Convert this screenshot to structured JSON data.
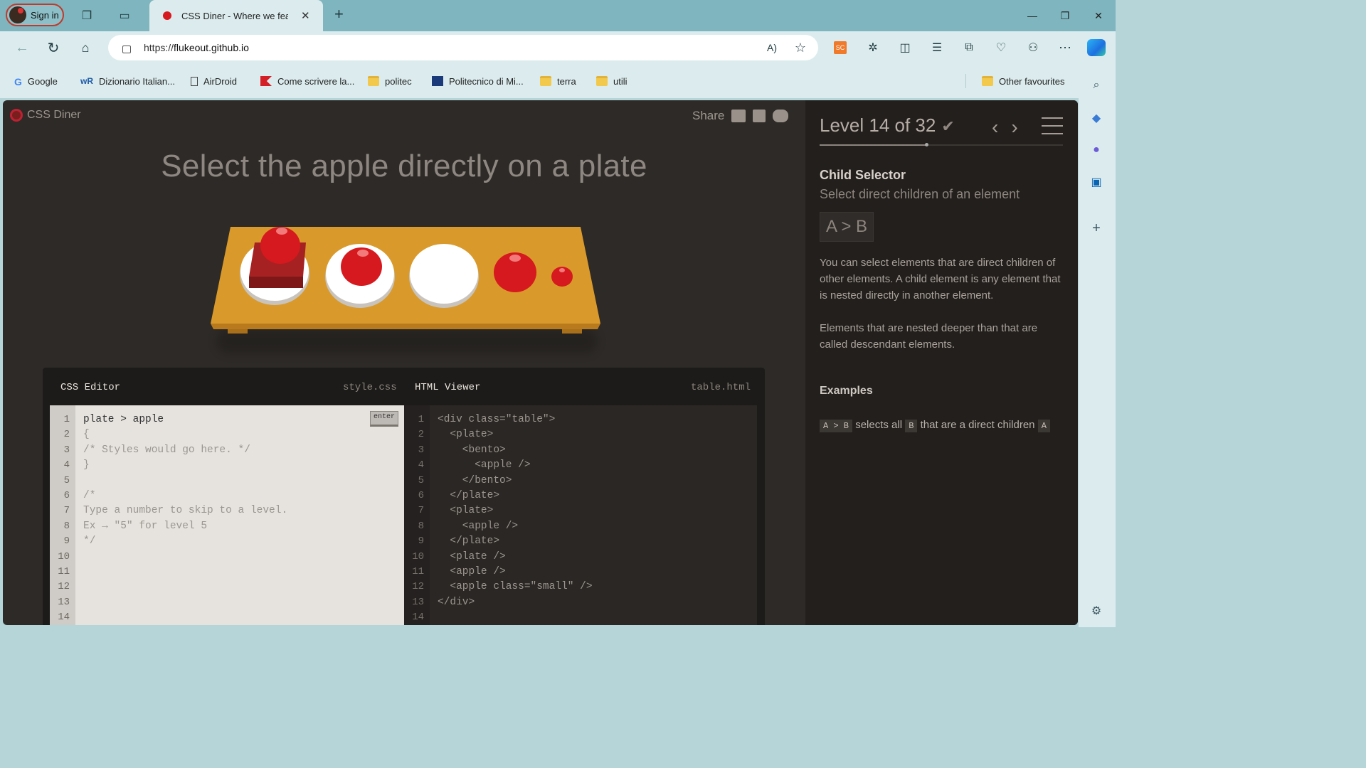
{
  "browser": {
    "signin_label": "Sign in",
    "tab_title": "CSS Diner - Where we feast",
    "url_scheme": "https://",
    "url_host": "flukeout.github.io",
    "bookmarks": [
      {
        "label": "Google",
        "icon": "google-icon"
      },
      {
        "label": "Dizionario Italian...",
        "icon": "wordreference-icon"
      },
      {
        "label": "AirDroid",
        "icon": "page-icon"
      },
      {
        "label": "Come scrivere la...",
        "icon": "red-flag-icon"
      },
      {
        "label": "politec",
        "icon": "folder-icon"
      },
      {
        "label": "Politecnico di Mi...",
        "icon": "polimi-icon"
      },
      {
        "label": "terra",
        "icon": "folder-icon"
      },
      {
        "label": "utili",
        "icon": "folder-icon"
      }
    ],
    "other_favourites": "Other favourites"
  },
  "app": {
    "brand": "CSS Diner",
    "share_label": "Share",
    "instruction": "Select the apple directly on a plate",
    "level_text": "Level 14 of 32",
    "level_current": 14,
    "level_total": 32,
    "selector_name": "Child Selector",
    "selector_desc": "Select direct children of an element",
    "syntax": "A > B",
    "help_p1": "You can select elements that are direct children of other elements. A child element is any element that is nested directly in another element.",
    "help_p2": "Elements that are nested deeper than that are called descendant elements.",
    "examples_head": "Examples",
    "example": {
      "tag_a": "A > B",
      "mid": "selects all",
      "tag_b": "B",
      "tail": "that are a direct children",
      "tag_c": "A"
    }
  },
  "editor": {
    "css_title": "CSS Editor",
    "css_file": "style.css",
    "html_title": "HTML Viewer",
    "html_file": "table.html",
    "enter_label": "enter",
    "css_input": "plate > apple",
    "css_lines": [
      "",
      "{",
      "/* Styles would go here. */",
      "}",
      "",
      "/*",
      "Type a number to skip to a level.",
      "Ex → \"5\" for level 5",
      "*/",
      "",
      "",
      "",
      "",
      ""
    ],
    "html_lines": [
      "<div class=\"table\">",
      "  <plate>",
      "    <bento>",
      "      <apple />",
      "    </bento>",
      "  </plate>",
      "  <plate>",
      "    <apple />",
      "  </plate>",
      "  <plate />",
      "  <apple />",
      "  <apple class=\"small\" />",
      "</div>",
      ""
    ],
    "line_numbers": [
      "1",
      "2",
      "3",
      "4",
      "5",
      "6",
      "7",
      "8",
      "9",
      "10",
      "11",
      "12",
      "13",
      "14"
    ]
  },
  "colors": {
    "accent": "#d6191e",
    "table": "#d99a2b",
    "sidebar": "#221f1d"
  }
}
